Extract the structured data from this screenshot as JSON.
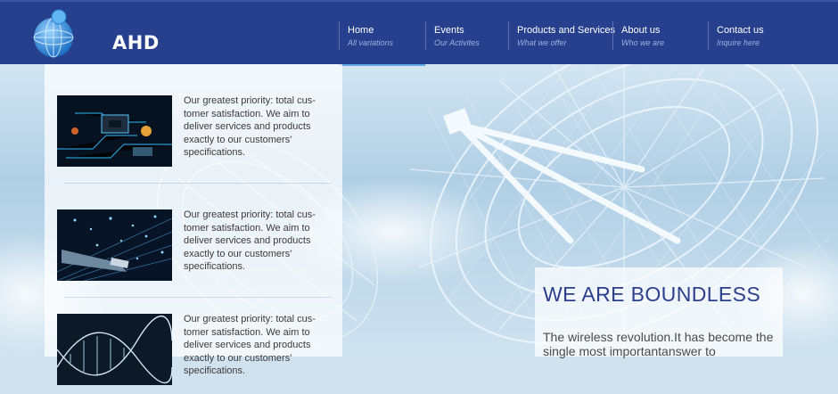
{
  "logo": {
    "text": "AHD"
  },
  "nav": [
    {
      "title": "Home",
      "subtitle": "All variations"
    },
    {
      "title": "Events",
      "subtitle": "Our Activites"
    },
    {
      "title": "Products and Services",
      "subtitle": "What we offer"
    },
    {
      "title": "About us",
      "subtitle": "Who we are"
    },
    {
      "title": "Contact us",
      "subtitle": "Inquire here"
    }
  ],
  "features": [
    {
      "text": "Our greatest priority: total cus-tomer satisfaction. We aim to deliver services and products exactly to our customers' specifications.",
      "image": "circuit-board-image"
    },
    {
      "text": "Our greatest priority: total cus-tomer satisfaction. We aim to deliver services and products exactly to our customers' specifications.",
      "image": "fiber-optic-image"
    },
    {
      "text": "Our greatest priority: total cus-tomer satisfaction. We aim to deliver services and products exactly to our customers' specifications.",
      "image": "dna-image"
    }
  ],
  "hero": {
    "title": "WE ARE BOUNDLESS",
    "text": "The wireless revolution.It has become the single most importantanswer to"
  },
  "colors": {
    "header": "#26408e",
    "accent": "#2b3f8c",
    "active_underline": "#5ea6e0"
  }
}
